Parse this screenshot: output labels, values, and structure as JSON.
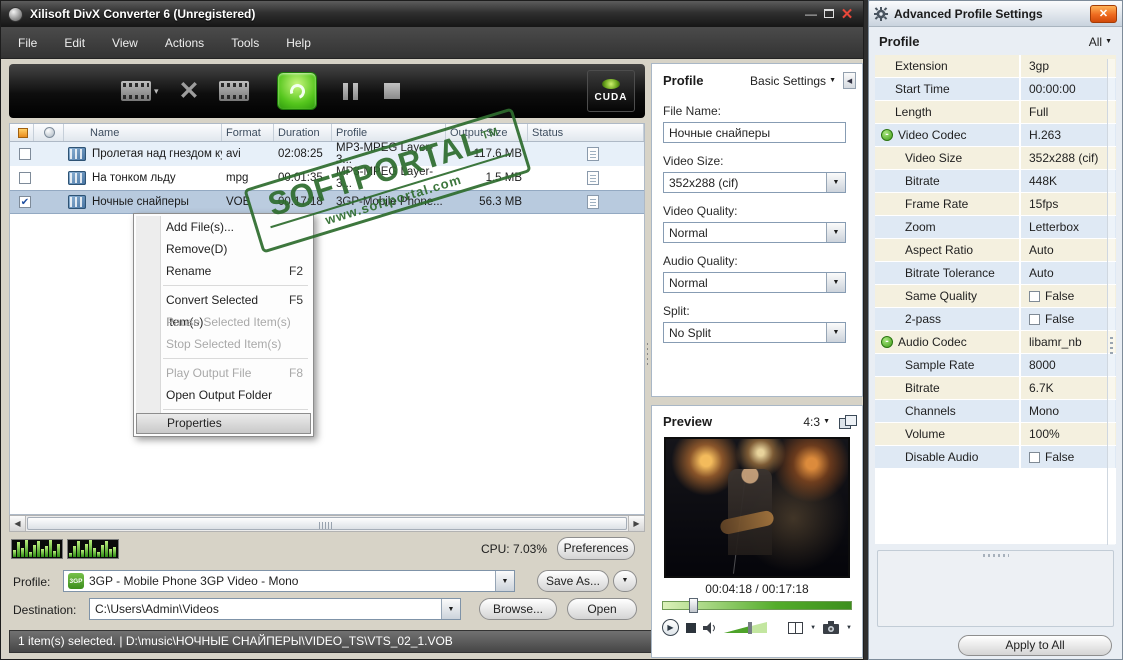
{
  "window": {
    "title": "Xilisoft DivX Converter 6 (Unregistered)",
    "menu_items": [
      "File",
      "Edit",
      "View",
      "Actions",
      "Tools",
      "Help"
    ],
    "cuda_label": "CUDA"
  },
  "file_list": {
    "headers": {
      "name": "Name",
      "format": "Format",
      "duration": "Duration",
      "profile": "Profile",
      "output_size": "Output Size",
      "status": "Status"
    },
    "rows": [
      {
        "checked": false,
        "selected": false,
        "name": "Пролетая над гнездом кук...",
        "format": "avi",
        "duration": "02:08:25",
        "profile": "MP3-MPEG Layer-3...",
        "output_size": "117.6 MB"
      },
      {
        "checked": false,
        "selected": false,
        "name": "На тонком льду",
        "format": "mpg",
        "duration": "00:01:35",
        "profile": "MP3-MPEG Layer-3...",
        "output_size": "1.5 MB"
      },
      {
        "checked": true,
        "selected": true,
        "name": "Ночные снайперы",
        "format": "VOB",
        "duration": "00:17:18",
        "profile": "3GP-Mobile Phone...",
        "output_size": "56.3 MB"
      }
    ]
  },
  "context_menu": {
    "items": [
      {
        "label": "Add File(s)...",
        "shortcut": "",
        "state": "enabled"
      },
      {
        "label": "Remove(D)",
        "shortcut": "",
        "state": "enabled"
      },
      {
        "label": "Rename",
        "shortcut": "F2",
        "state": "enabled"
      },
      {
        "type": "separator"
      },
      {
        "label": "Convert Selected Item(s)",
        "shortcut": "F5",
        "state": "enabled"
      },
      {
        "label": "Pause Selected Item(s)",
        "shortcut": "",
        "state": "disabled"
      },
      {
        "label": "Stop Selected Item(s)",
        "shortcut": "",
        "state": "disabled"
      },
      {
        "type": "separator"
      },
      {
        "label": "Play Output File",
        "shortcut": "F8",
        "state": "disabled"
      },
      {
        "label": "Open Output Folder",
        "shortcut": "",
        "state": "enabled"
      },
      {
        "type": "separator"
      },
      {
        "label": "Properties",
        "shortcut": "",
        "state": "highlighted"
      }
    ]
  },
  "watermark": {
    "name": "SOFTPORTAL",
    "tm": "TM",
    "url": "www.softportal.com"
  },
  "status_area": {
    "cpu": "CPU: 7.03%",
    "preferences_label": "Preferences",
    "profile_label": "Profile:",
    "profile_badge": "3GP",
    "profile_value": "3GP - Mobile Phone 3GP Video - Mono",
    "save_as_label": "Save As...",
    "save_as_arrow": "▼",
    "destination_label": "Destination:",
    "destination_value": "C:\\Users\\Admin\\Videos",
    "browse_label": "Browse...",
    "open_label": "Open",
    "status_text": "1 item(s) selected. | D:\\music\\НОЧНЫЕ СНАЙПЕРЫ\\VIDEO_TS\\VTS_02_1.VOB"
  },
  "profile_panel": {
    "title": "Profile",
    "mode": "Basic Settings",
    "fields": [
      {
        "label": "File Name:",
        "value": "Ночные снайперы",
        "type": "input"
      },
      {
        "label": "Video Size:",
        "value": "352x288 (cif)",
        "type": "combo"
      },
      {
        "label": "Video Quality:",
        "value": "Normal",
        "type": "combo"
      },
      {
        "label": "Audio Quality:",
        "value": "Normal",
        "type": "combo"
      },
      {
        "label": "Split:",
        "value": "No Split",
        "type": "combo"
      }
    ]
  },
  "preview_panel": {
    "title": "Preview",
    "aspect": "4:3",
    "time": "00:04:18 / 00:17:18"
  },
  "advanced_window": {
    "title": "Advanced Profile Settings",
    "section_title": "Profile",
    "filter": "All",
    "rows": [
      {
        "label": "Extension",
        "value": "3gp",
        "level": 0
      },
      {
        "label": "Start Time",
        "value": "00:00:00",
        "level": 0
      },
      {
        "label": "Length",
        "value": "Full",
        "level": 0
      },
      {
        "label": "Video Codec",
        "value": "H.263",
        "level": 0,
        "group": true
      },
      {
        "label": "Video Size",
        "value": "352x288 (cif)",
        "level": 1
      },
      {
        "label": "Bitrate",
        "value": "448K",
        "level": 1
      },
      {
        "label": "Frame Rate",
        "value": "15fps",
        "level": 1
      },
      {
        "label": "Zoom",
        "value": "Letterbox",
        "level": 1
      },
      {
        "label": "Aspect Ratio",
        "value": "Auto",
        "level": 1
      },
      {
        "label": "Bitrate Tolerance",
        "value": "Auto",
        "level": 1
      },
      {
        "label": "Same Quality",
        "value": "False",
        "level": 1,
        "checkbox": true
      },
      {
        "label": "2-pass",
        "value": "False",
        "level": 1,
        "checkbox": true
      },
      {
        "label": "Audio Codec",
        "value": "libamr_nb",
        "level": 0,
        "group": true
      },
      {
        "label": "Sample Rate",
        "value": "8000",
        "level": 1
      },
      {
        "label": "Bitrate",
        "value": "6.7K",
        "level": 1
      },
      {
        "label": "Channels",
        "value": "Mono",
        "level": 1
      },
      {
        "label": "Volume",
        "value": "100%",
        "level": 1
      },
      {
        "label": "Disable Audio",
        "value": "False",
        "level": 1,
        "checkbox": true
      }
    ],
    "apply_label": "Apply to All"
  }
}
